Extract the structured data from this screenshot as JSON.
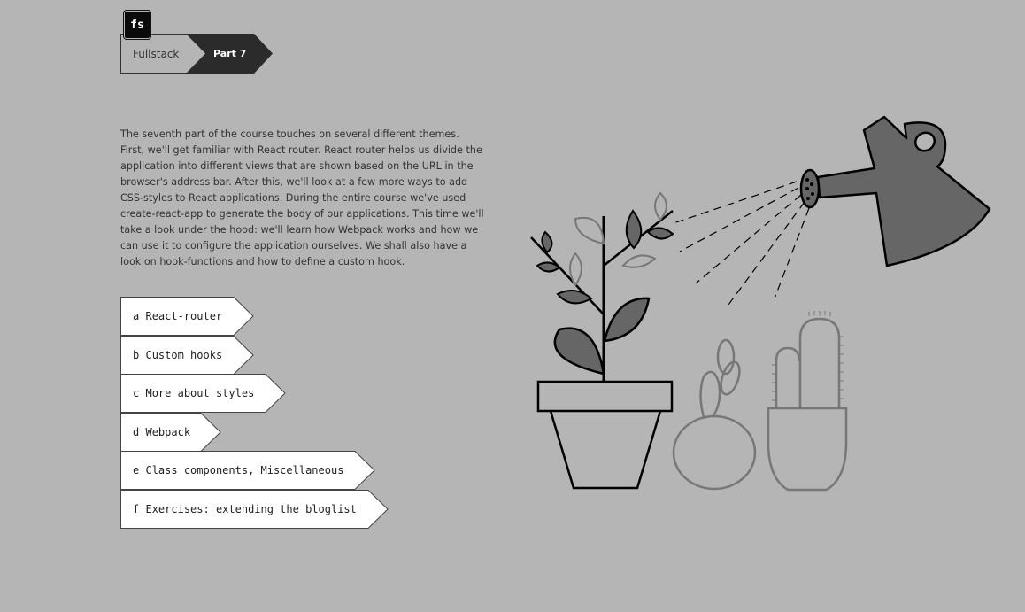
{
  "logo": {
    "text": "fs"
  },
  "breadcrumb": {
    "items": [
      {
        "label": "Fullstack"
      },
      {
        "label": "Part 7"
      }
    ]
  },
  "intro": {
    "text": "The seventh part of the course touches on several different themes. First, we'll get familiar with React router. React router helps us divide the application into different views that are shown based on the URL in the browser's address bar. After this, we'll look at a few more ways to add CSS-styles to React applications. During the entire course we've used create-react-app to generate the body of our applications. This time we'll take a look under the hood: we'll learn how Webpack works and how we can use it to configure the application ourselves. We shall also have a look on hook-functions and how to define a custom hook."
  },
  "parts": [
    {
      "letter": "a",
      "title": "React-router"
    },
    {
      "letter": "b",
      "title": "Custom hooks"
    },
    {
      "letter": "c",
      "title": "More about styles"
    },
    {
      "letter": "d",
      "title": "Webpack"
    },
    {
      "letter": "e",
      "title": "Class components, Miscellaneous"
    },
    {
      "letter": "f",
      "title": "Exercises: extending the bloglist"
    }
  ],
  "illustration": {
    "subject": "watering-can-and-potted-plants",
    "colors": {
      "fill_dark": "#666666",
      "stroke": "#000000",
      "stroke_light": "#777777",
      "background": "#b5b5b5"
    }
  }
}
